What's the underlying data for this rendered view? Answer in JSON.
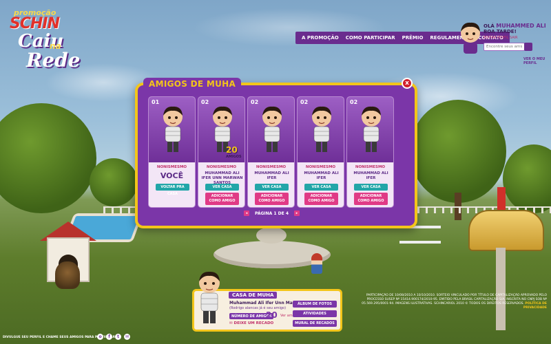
{
  "logo": {
    "promo": "promoção",
    "brand": "SCHIN",
    "caiu": "Caiu",
    "na": "na",
    "rede": "Rede"
  },
  "nav": [
    "A PROMOÇÃO",
    "COMO PARTICIPAR",
    "PRÊMIO",
    "REGULAMENTO",
    "CONTATO"
  ],
  "greeting": {
    "hello": "OLÁ",
    "user": "MUHAMMED ALI",
    "sub": "BOA TARDE!",
    "links": "EDITAR PERFIL    SAIR",
    "search_placeholder": "Encontre seus amigos",
    "my_profile": "VER O MEU PERFIL"
  },
  "panel": {
    "title": "AMIGOS DE MUHA",
    "close": "x",
    "pager": "PÁGINA 1 DE 4",
    "prev": "◂",
    "next": "▸"
  },
  "cards": [
    {
      "rank": "01",
      "nick": "NONISMESMO",
      "name": "VOCÊ",
      "primary": "VOLTAR PRA CASA"
    },
    {
      "rank": "02",
      "nick": "NONISMESMO",
      "name": "MUHAMMAD ALI IFER UNN MARWAN SANTOS",
      "primary": "VER CASA",
      "secondary": "ADICIONAR COMO AMIGO",
      "badge": "20",
      "badge_label": "AMIGOS"
    },
    {
      "rank": "02",
      "nick": "NONISMESMO",
      "name": "MUHAMMAD ALI IFER",
      "primary": "VER CASA",
      "secondary": "ADICIONAR COMO AMIGO"
    },
    {
      "rank": "02",
      "nick": "NONISMESMO",
      "name": "MUHAMMAD ALI IFER",
      "primary": "VER CASA",
      "secondary": "ADICIONAR COMO AMIGO"
    },
    {
      "rank": "02",
      "nick": "NONISMESMO",
      "name": "MUHAMMAD ALI IFER",
      "primary": "VER CASA",
      "secondary": "ADICIONAR COMO AMIGO"
    }
  ],
  "casa": {
    "title": "CASA DE MUHA",
    "name": "Muhammad Ali Ifer Unn Marwan Santos",
    "hint": "(Rodrigo alancas já é seu amigo)",
    "friends_label": "NÚMERO DE AMIGOS",
    "friends_count": "20",
    "ver_amigos": "Ver amigos",
    "recado": "DEIXE UM RECADO",
    "buttons": [
      "ÁLBUM DE FOTOS",
      "ATIVIDADES",
      "MURAL DE RECADOS"
    ]
  },
  "footer": {
    "left": "DIVULGUE SEU PERFIL E CHAME SEUS AMIGOS PARA PARTICIPAR",
    "icons": [
      "o",
      "f",
      "t",
      "✉"
    ],
    "legal": "PARTICIPAÇÃO DE 10/08/2010 A 10/10/2010. SORTEIO VINCULADO POR TÍTULO DE CAPITALIZAÇÃO APROVADO PELO PROCESSO SUSEP Nº 15414.900174/2010-95. EMITIDO PELA BRASIL CAPITALIZAÇÃO S/A, INSCRITA NO CNPJ SOB Nº 05.569.295/0001-94. IMAGENS ILUSTRATIVAS. SCHINCARIOL 2010 © TODOS OS DIREITOS RESERVADOS.",
    "privacy": "POLÍTICA DE PRIVACIDADE"
  }
}
